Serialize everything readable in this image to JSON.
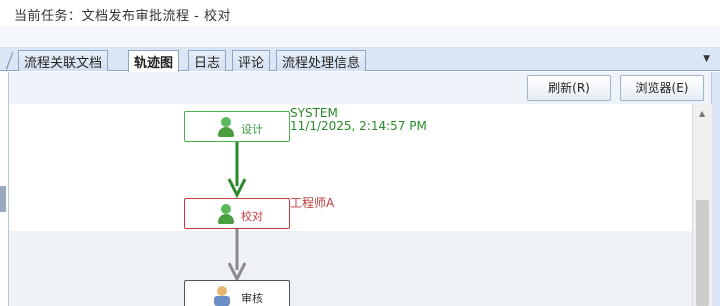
{
  "header": {
    "task_label": "当前任务：文档发布审批流程 - 校对"
  },
  "tabs": [
    {
      "label": "流程关联文档",
      "active": false
    },
    {
      "label": "轨迹图",
      "active": true
    },
    {
      "label": "日志",
      "active": false
    },
    {
      "label": "评论",
      "active": false
    },
    {
      "label": "流程处理信息",
      "active": false
    }
  ],
  "toolbar": {
    "refresh_label": "刷新(R)",
    "browser_label": "浏览器(E)"
  },
  "flow": {
    "nodes": [
      {
        "label": "设计",
        "status": "completed",
        "color": "#3a9a3a"
      },
      {
        "label": "校对",
        "status": "current",
        "color": "#c23b3b"
      },
      {
        "label": "审核",
        "status": "pending",
        "color": "#555555"
      }
    ],
    "design_meta": {
      "user": "SYSTEM",
      "time": "11/1/2025, 2:14:57 PM"
    },
    "proof_meta": {
      "user": "工程师A"
    }
  },
  "colors": {
    "done": "#2a8a2a",
    "active": "#c23b3b",
    "pending": "#8a8a8a"
  }
}
